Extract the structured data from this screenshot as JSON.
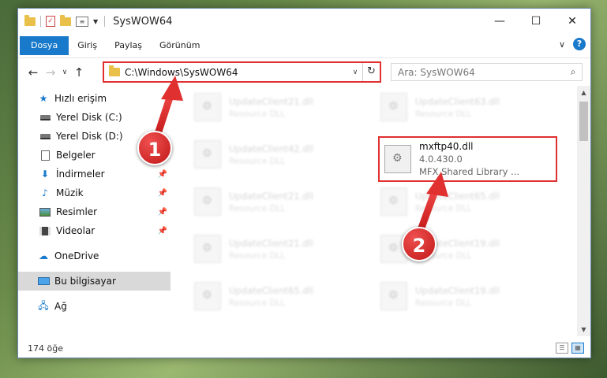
{
  "window": {
    "title": "SysWOW64",
    "controls": {
      "minimize": "—",
      "maximize": "☐",
      "close": "✕"
    }
  },
  "ribbon": {
    "tabs": [
      {
        "label": "Dosya",
        "active": true
      },
      {
        "label": "Giriş"
      },
      {
        "label": "Paylaş"
      },
      {
        "label": "Görünüm"
      }
    ],
    "expand_icon": "chevron-down-icon",
    "help_label": "?"
  },
  "address": {
    "path": "C:\\Windows\\SysWOW64",
    "search_placeholder": "Ara: SysWOW64"
  },
  "nav": {
    "items": [
      {
        "label": "Hızlı erişim",
        "icon": "star-icon"
      },
      {
        "label": "Yerel Disk (C:)",
        "icon": "disk-icon"
      },
      {
        "label": "Yerel Disk (D:)",
        "icon": "disk-icon"
      },
      {
        "label": "Belgeler",
        "icon": "documents-icon",
        "pinned": true
      },
      {
        "label": "İndirmeler",
        "icon": "download-icon",
        "pinned": true
      },
      {
        "label": "Müzik",
        "icon": "music-icon",
        "pinned": true
      },
      {
        "label": "Resimler",
        "icon": "pictures-icon",
        "pinned": true
      },
      {
        "label": "Videolar",
        "icon": "videos-icon",
        "pinned": true
      },
      {
        "label": "OneDrive",
        "icon": "cloud-icon"
      },
      {
        "label": "Bu bilgisayar",
        "icon": "computer-icon",
        "selected": true
      },
      {
        "label": "Ağ",
        "icon": "network-icon"
      }
    ]
  },
  "files": [
    {
      "name": "UpdateClient21.dll",
      "desc": "Resource DLL"
    },
    {
      "name": "UpdateClient63.dll",
      "desc": "Resource DLL"
    },
    {
      "name": "UpdateClient42.dll",
      "desc": "Resource DLL"
    },
    {
      "name": "mxftp40.dll",
      "version": "4.0.430.0",
      "desc": "MFX Shared Library ...",
      "highlighted": true
    },
    {
      "name": "UpdateClient21.dll",
      "desc": "Resource DLL"
    },
    {
      "name": "UpdateClient65.dll",
      "desc": "Resource DLL"
    },
    {
      "name": "UpdateClient21.dll",
      "desc": "Resource DLL"
    },
    {
      "name": "UpdateClient19.dll",
      "desc": "Resource DLL"
    },
    {
      "name": "UpdateClient65.dll",
      "desc": "Resource DLL"
    },
    {
      "name": "UpdateClient19.dll",
      "desc": "Resource DLL"
    }
  ],
  "status": {
    "item_count": "174 öğe"
  },
  "callouts": {
    "one": "1",
    "two": "2"
  },
  "colors": {
    "accent": "#1979ca",
    "highlight": "#e03030"
  }
}
